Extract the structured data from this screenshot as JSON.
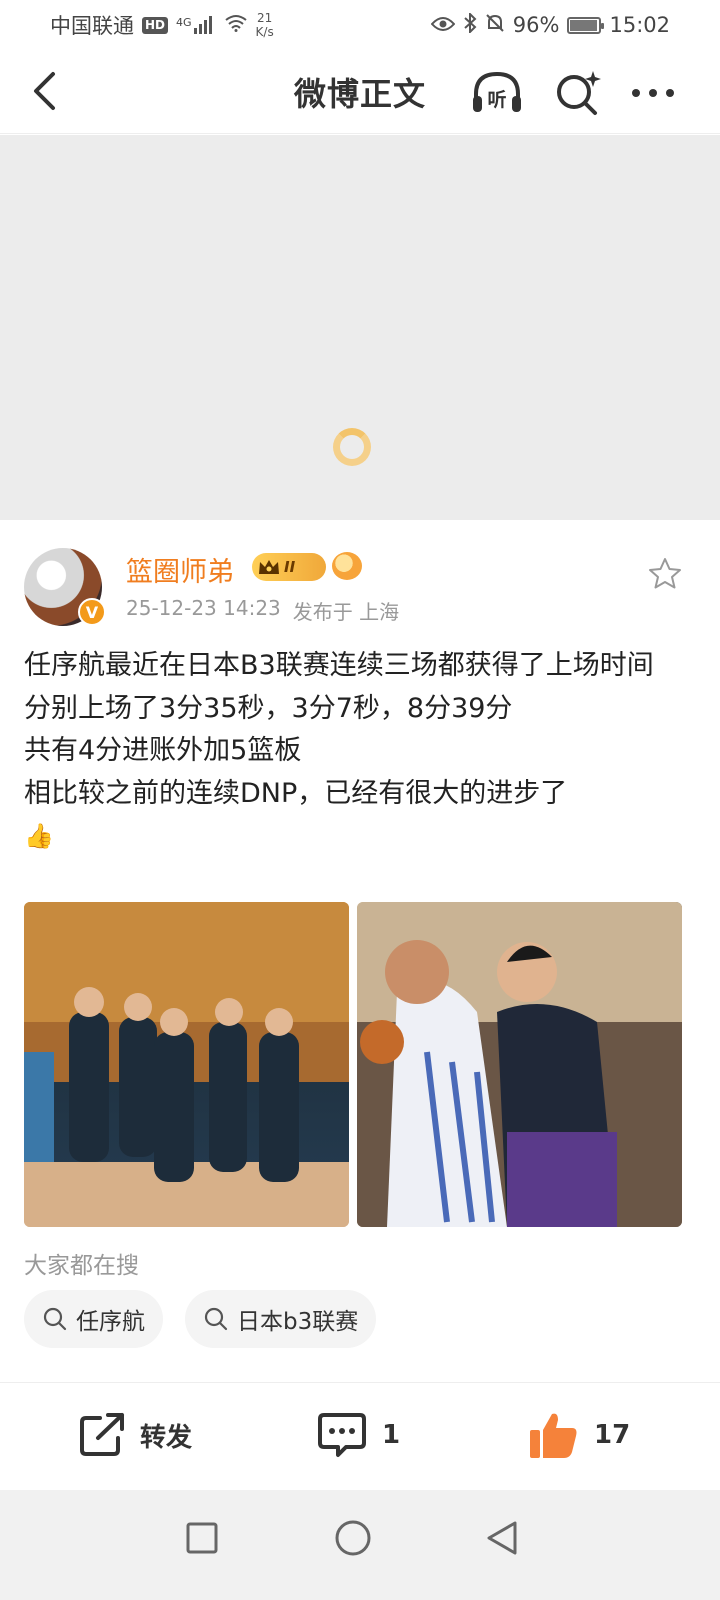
{
  "status_bar": {
    "carrier": "中国联通",
    "hd": "HD",
    "signal_type": "4G",
    "net_speed_value": "21",
    "net_speed_unit": "K/s",
    "battery_percent": "96%",
    "battery_level": 0.96,
    "time": "15:02"
  },
  "header": {
    "title": "微博正文",
    "listen_label": "听"
  },
  "author": {
    "name": "篮圈师弟",
    "vip_level": "II",
    "verified_mark": "V",
    "timestamp": "25-12-23 14:23",
    "location": "发布于 上海"
  },
  "post": {
    "lines": [
      "任序航最近在日本B3联赛连续三场都获得了上场时间",
      "分别上场了3分35秒，3分7秒，8分39分",
      "共有4分进账外加5篮板",
      "相比较之前的连续DNP，已经有很大的进步了"
    ],
    "emoji": "👍"
  },
  "hot_search": {
    "label": "大家都在搜",
    "chips": [
      "任序航",
      "日本b3联赛"
    ]
  },
  "actions": {
    "repost_label": "转发",
    "comment_count": "1",
    "like_count": "17"
  },
  "colors": {
    "accent_orange": "#f07d1f",
    "like_orange": "#f5823a"
  },
  "icons": {
    "back": "chevron-left-icon",
    "listen": "headphones-icon",
    "search": "search-sparkle-icon",
    "more": "more-dots-icon",
    "favorite": "star-outline-icon",
    "repost": "share-icon",
    "comment": "comment-bubble-icon",
    "like": "thumbs-up-icon"
  }
}
